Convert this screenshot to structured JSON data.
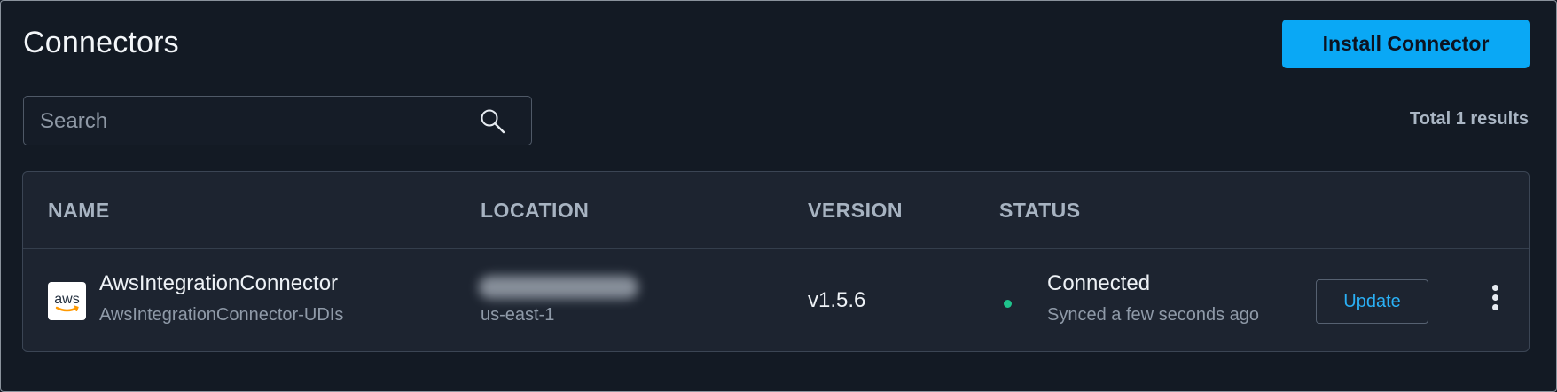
{
  "page": {
    "title": "Connectors",
    "install_button_label": "Install Connector",
    "total_results": "Total 1 results"
  },
  "search": {
    "placeholder": "Search",
    "value": ""
  },
  "table": {
    "columns": [
      "NAME",
      "LOCATION",
      "VERSION",
      "STATUS"
    ],
    "rows": [
      {
        "icon": "aws-logo-icon",
        "name": "AwsIntegrationConnector",
        "subname": "AwsIntegrationConnector-UDIs",
        "location_primary_redacted": true,
        "location_secondary": "us-east-1",
        "version": "v1.5.6",
        "status": "Connected",
        "status_detail": "Synced a few seconds ago",
        "status_color": "#1fc38c",
        "action_label": "Update"
      }
    ]
  },
  "colors": {
    "background": "#131a24",
    "accent": "#0aa8f5",
    "table_bg": "#1d2430",
    "link": "#2ab0f5"
  }
}
